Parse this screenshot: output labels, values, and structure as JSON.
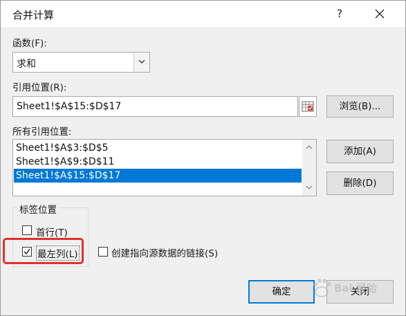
{
  "dialog": {
    "title": "合并计算",
    "help_label": "?",
    "close_label": "✕"
  },
  "function": {
    "label": "函数(F):",
    "selected": "求和"
  },
  "reference": {
    "label": "引用位置(R):",
    "value": "Sheet1!$A$15:$D$17",
    "browse_label": "浏览(B)..."
  },
  "all_references": {
    "label": "所有引用位置:",
    "items": [
      "Sheet1!$A$3:$D$5",
      "Sheet1!$A$9:$D$11",
      "Sheet1!$A$15:$D$17"
    ],
    "selected_index": 2,
    "add_label": "添加(A)",
    "delete_label": "删除(D)"
  },
  "label_position": {
    "group_title": "标签位置",
    "top_row": {
      "label": "首行(T)",
      "checked": false
    },
    "left_column": {
      "label": "最左列(L)",
      "checked": true
    }
  },
  "link_source": {
    "label": "创建指向源数据的链接(S)",
    "checked": false
  },
  "buttons": {
    "ok": "确定",
    "close": "关闭"
  },
  "watermark": {
    "text": "Bai 经验"
  },
  "colors": {
    "selection": "#0078d7",
    "highlight": "#e0312c"
  }
}
